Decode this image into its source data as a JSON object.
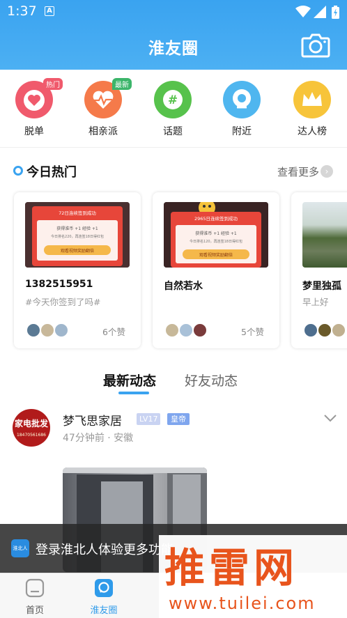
{
  "status": {
    "time": "1:37",
    "a_badge": "A"
  },
  "header": {
    "title": "淮友圈"
  },
  "categories": [
    {
      "label": "脱单",
      "tag": "热门",
      "color": "#f05a6c",
      "tag_color": "#f05a6c"
    },
    {
      "label": "相亲派",
      "tag": "最新",
      "color": "#f57a4a",
      "tag_color": "#3cb56a"
    },
    {
      "label": "话题",
      "tag": "",
      "color": "#57c24c"
    },
    {
      "label": "附近",
      "tag": "",
      "color": "#4fb6ef"
    },
    {
      "label": "达人榜",
      "tag": "",
      "color": "#f7c43a"
    }
  ],
  "hot": {
    "title": "今日热门",
    "more": "查看更多",
    "cards": [
      {
        "name": "1382515951",
        "sub": "#今天你签到了吗#",
        "likes": "6个赞",
        "img": {
          "title": "72日连续签到成功",
          "line1": "获得淮币 +1  经验 +1",
          "line2": "今日排名220，再连签18日得红包",
          "button": "观看视频奖励翻倍"
        }
      },
      {
        "name": "自然若水",
        "sub": "",
        "likes": "5个赞",
        "img": {
          "title": "2965日连续签到成功",
          "line1": "获得淮币 +1  经验 +1",
          "line2": "今日排名120，再连签18日得红包",
          "button": "观看视频奖励翻倍"
        }
      },
      {
        "name": "梦里独孤",
        "sub": "早上好",
        "likes": ""
      }
    ]
  },
  "tabs": {
    "latest": "最新动态",
    "friends": "好友动态"
  },
  "post": {
    "avatar_text": "家电批发",
    "avatar_phone": "18470561686",
    "name": "梦飞思家居",
    "level": "LV17",
    "rank": "皇帝",
    "meta": "47分钟前 · 安徽"
  },
  "login_banner": {
    "logo_text": "淮北人",
    "text": "登录淮北人体验更多功能"
  },
  "nav": {
    "home": "首页",
    "circle": "淮友圈"
  },
  "watermark": {
    "big": "推雷网",
    "small": "www.tuilei.com"
  },
  "colors": {
    "accent": "#3aa3f0",
    "watermark": "#e8541c"
  }
}
